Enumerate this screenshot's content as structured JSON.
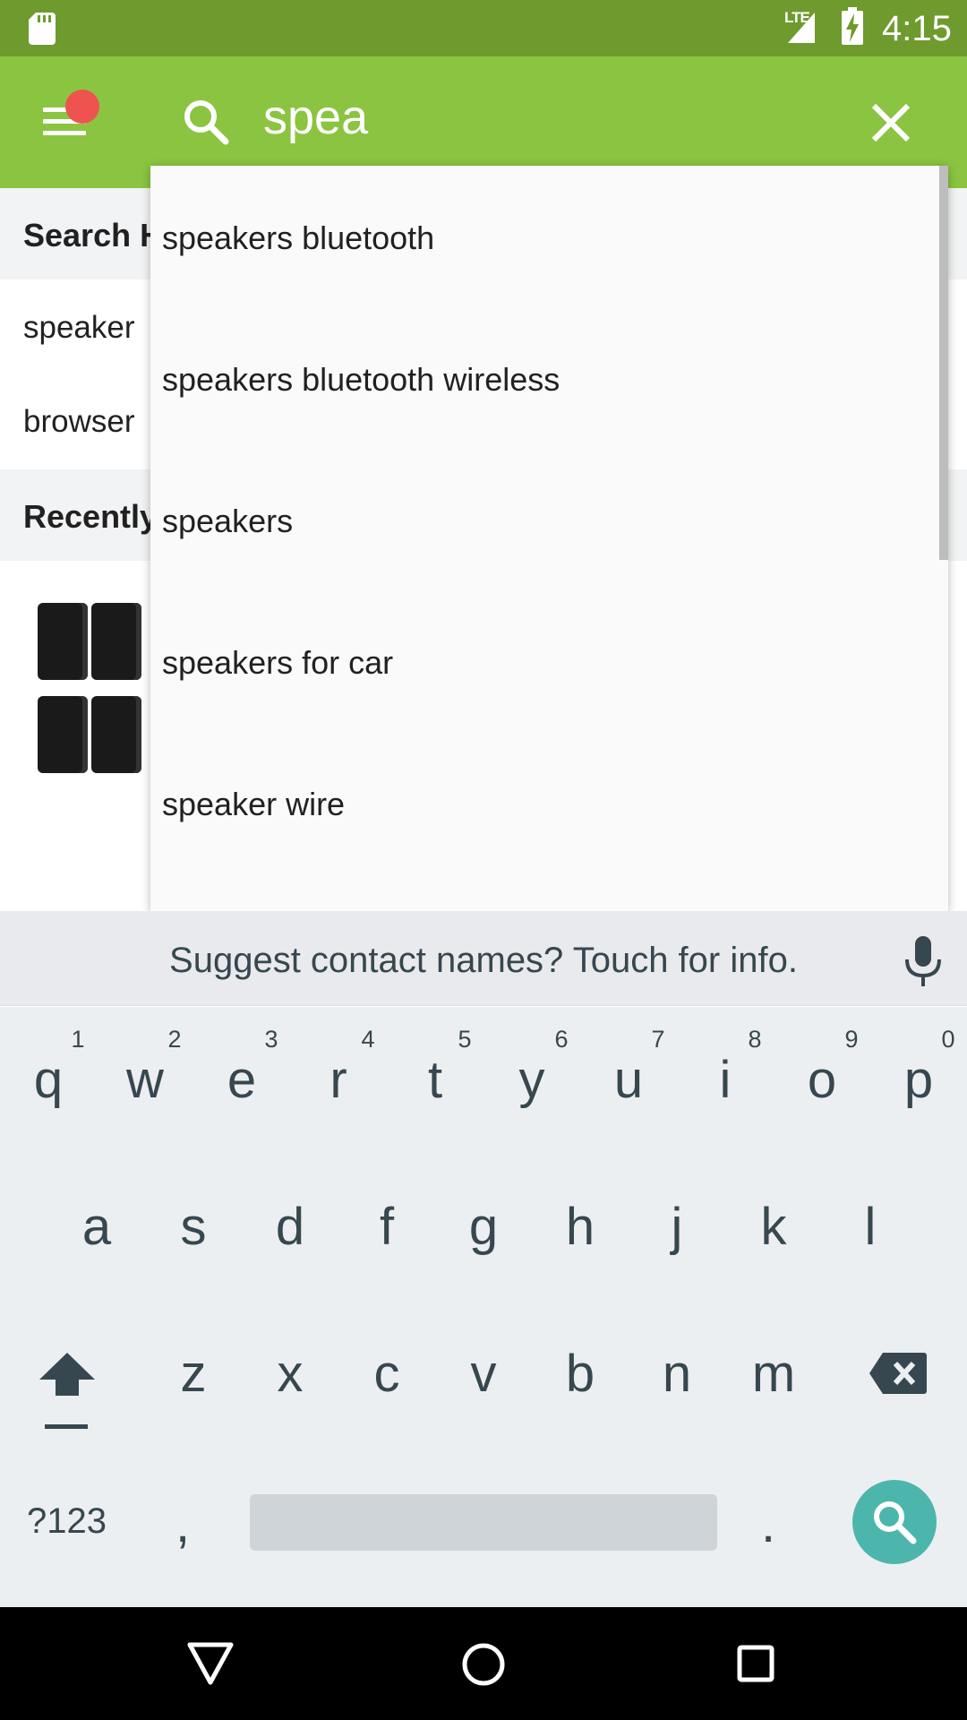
{
  "status_bar": {
    "network": "LTE",
    "time": "4:15"
  },
  "search": {
    "query": "spea"
  },
  "sections": {
    "history_title": "Search H",
    "history_items": [
      "speaker",
      "browser"
    ],
    "recent_title": "Recently"
  },
  "suggestions": [
    "speakers bluetooth",
    "speakers bluetooth wireless",
    "speakers",
    "speakers for car",
    "speaker wire"
  ],
  "keyboard": {
    "suggestion_strip": "Suggest contact names? Touch for info.",
    "row1": [
      "q",
      "w",
      "e",
      "r",
      "t",
      "y",
      "u",
      "i",
      "o",
      "p"
    ],
    "row1_hints": [
      "1",
      "2",
      "3",
      "4",
      "5",
      "6",
      "7",
      "8",
      "9",
      "0"
    ],
    "row2": [
      "a",
      "s",
      "d",
      "f",
      "g",
      "h",
      "j",
      "k",
      "l"
    ],
    "row3": [
      "z",
      "x",
      "c",
      "v",
      "b",
      "n",
      "m"
    ],
    "symbols_label": "?123",
    "comma": ",",
    "period": "."
  },
  "colors": {
    "status_bar": "#6f9a2e",
    "app_bar": "#8bc441",
    "notification_dot": "#ef5350",
    "search_action": "#4db6ac"
  }
}
